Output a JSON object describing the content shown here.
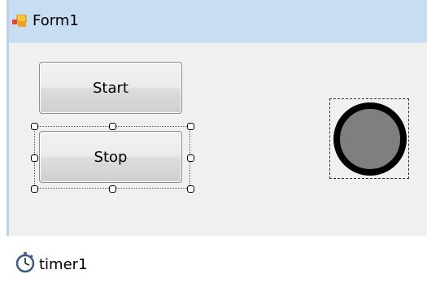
{
  "window": {
    "title": "Form1",
    "icon": "form-icon"
  },
  "buttons": {
    "start_label": "Start",
    "stop_label": "Stop"
  },
  "shape": {
    "icon": "circle-shape",
    "fill": "#7f7f7f",
    "stroke": "#000000"
  },
  "component_tray": {
    "items": [
      {
        "label": "timer1",
        "icon": "stopwatch-icon"
      }
    ]
  },
  "colors": {
    "titlebar": "#c8ddf2",
    "form_background": "#f0f0f0"
  }
}
